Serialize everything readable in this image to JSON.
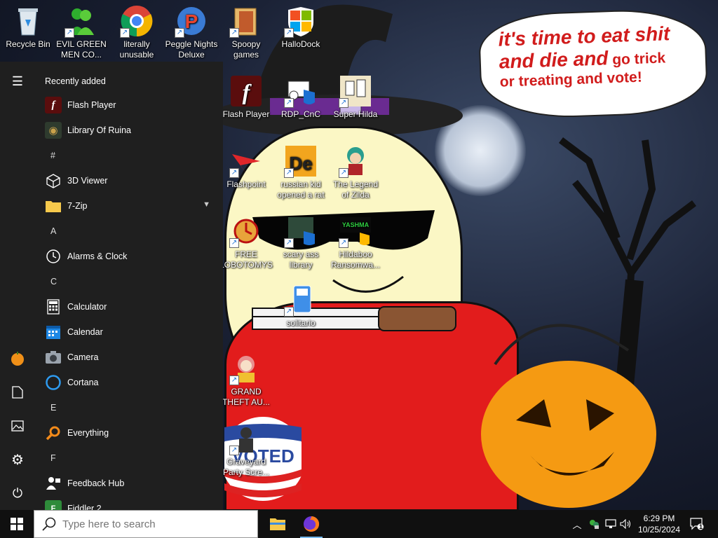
{
  "desktop": {
    "icons": [
      {
        "label": "Recycle Bin"
      },
      {
        "label": "EVIL GREEN MEN CO..."
      },
      {
        "label": "literally unusable"
      },
      {
        "label": "Peggle Nights Deluxe"
      },
      {
        "label": "Spoopy games"
      },
      {
        "label": "HalloDock"
      },
      {
        "label": "Flash Player"
      },
      {
        "label": "RDP_CnC"
      },
      {
        "label": "Super Hilda"
      },
      {
        "label": "Flashpoint"
      },
      {
        "label": "russian kid opened a rat"
      },
      {
        "label": "The Legend of Zilda"
      },
      {
        "label": "FREE LOBOTOMYS"
      },
      {
        "label": "scary ass library"
      },
      {
        "label": "Hildaboo Ransomwa..."
      },
      {
        "label": "solitario"
      },
      {
        "label": "GRAND THEFT AU..."
      },
      {
        "label": "Graveyard Party Scre..."
      }
    ],
    "speech_bubble": {
      "line1": "it's time to eat shit",
      "line2_big": "and die and",
      "line2_small": " go trick",
      "line3": "or treating and vote!"
    },
    "sticker_text": "VOTED"
  },
  "start_menu": {
    "recently_added_label": "Recently added",
    "items": [
      {
        "type": "app",
        "label": "Flash Player",
        "icon": "flash-icon"
      },
      {
        "type": "app",
        "label": "Library Of Ruina",
        "icon": "library-of-ruina-icon"
      },
      {
        "type": "letter",
        "label": "#"
      },
      {
        "type": "app",
        "label": "3D Viewer",
        "icon": "cube-icon"
      },
      {
        "type": "folder",
        "label": "7-Zip",
        "icon": "folder-icon"
      },
      {
        "type": "letter",
        "label": "A"
      },
      {
        "type": "app",
        "label": "Alarms & Clock",
        "icon": "clock-icon"
      },
      {
        "type": "letter",
        "label": "C"
      },
      {
        "type": "app",
        "label": "Calculator",
        "icon": "calculator-icon"
      },
      {
        "type": "app",
        "label": "Calendar",
        "icon": "calendar-icon"
      },
      {
        "type": "app",
        "label": "Camera",
        "icon": "camera-icon"
      },
      {
        "type": "app",
        "label": "Cortana",
        "icon": "cortana-icon"
      },
      {
        "type": "letter",
        "label": "E"
      },
      {
        "type": "app",
        "label": "Everything",
        "icon": "magnifier-icon"
      },
      {
        "type": "letter",
        "label": "F"
      },
      {
        "type": "app",
        "label": "Feedback Hub",
        "icon": "feedback-icon"
      },
      {
        "type": "app",
        "label": "Fiddler 2",
        "icon": "fiddler-icon"
      }
    ]
  },
  "taskbar": {
    "search_placeholder": "Type here to search",
    "clock_time": "6:29 PM",
    "clock_date": "10/25/2024",
    "notification_count": "1"
  },
  "colors": {
    "start_bg": "#1f1f1f",
    "taskbar_bg": "#101010",
    "accent": "#0078d7",
    "speech_text": "#d11c1c"
  }
}
